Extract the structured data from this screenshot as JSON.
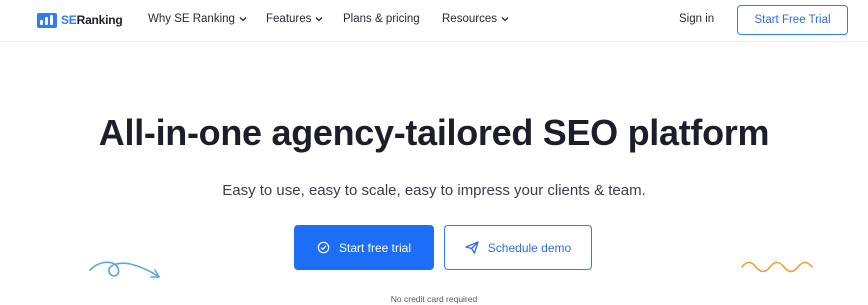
{
  "brand": {
    "prefix": "SE",
    "name": "Ranking"
  },
  "nav": {
    "items": [
      {
        "label": "Why SE Ranking",
        "has_dropdown": true
      },
      {
        "label": "Features",
        "has_dropdown": true
      },
      {
        "label": "Plans & pricing",
        "has_dropdown": false
      },
      {
        "label": "Resources",
        "has_dropdown": true
      }
    ],
    "sign_in": "Sign in",
    "cta": "Start Free Trial"
  },
  "hero": {
    "title": "All-in-one agency-tailored SEO platform",
    "subtitle": "Easy to use, easy to scale, easy to impress your clients & team.",
    "primary_cta": "Start free trial",
    "secondary_cta": "Schedule demo",
    "note": "No credit card required"
  },
  "icons": {
    "primary_cta": "check-circle-icon",
    "secondary_cta": "paper-plane-icon",
    "decorations": [
      "swirl-arrow-icon",
      "zigzag-icon"
    ]
  },
  "colors": {
    "brand_blue": "#2f7cf6",
    "primary_button": "#1d6ef6",
    "deco_left": "#5aa6e6",
    "deco_right": "#f0a030",
    "text": "#1c1e2a"
  }
}
